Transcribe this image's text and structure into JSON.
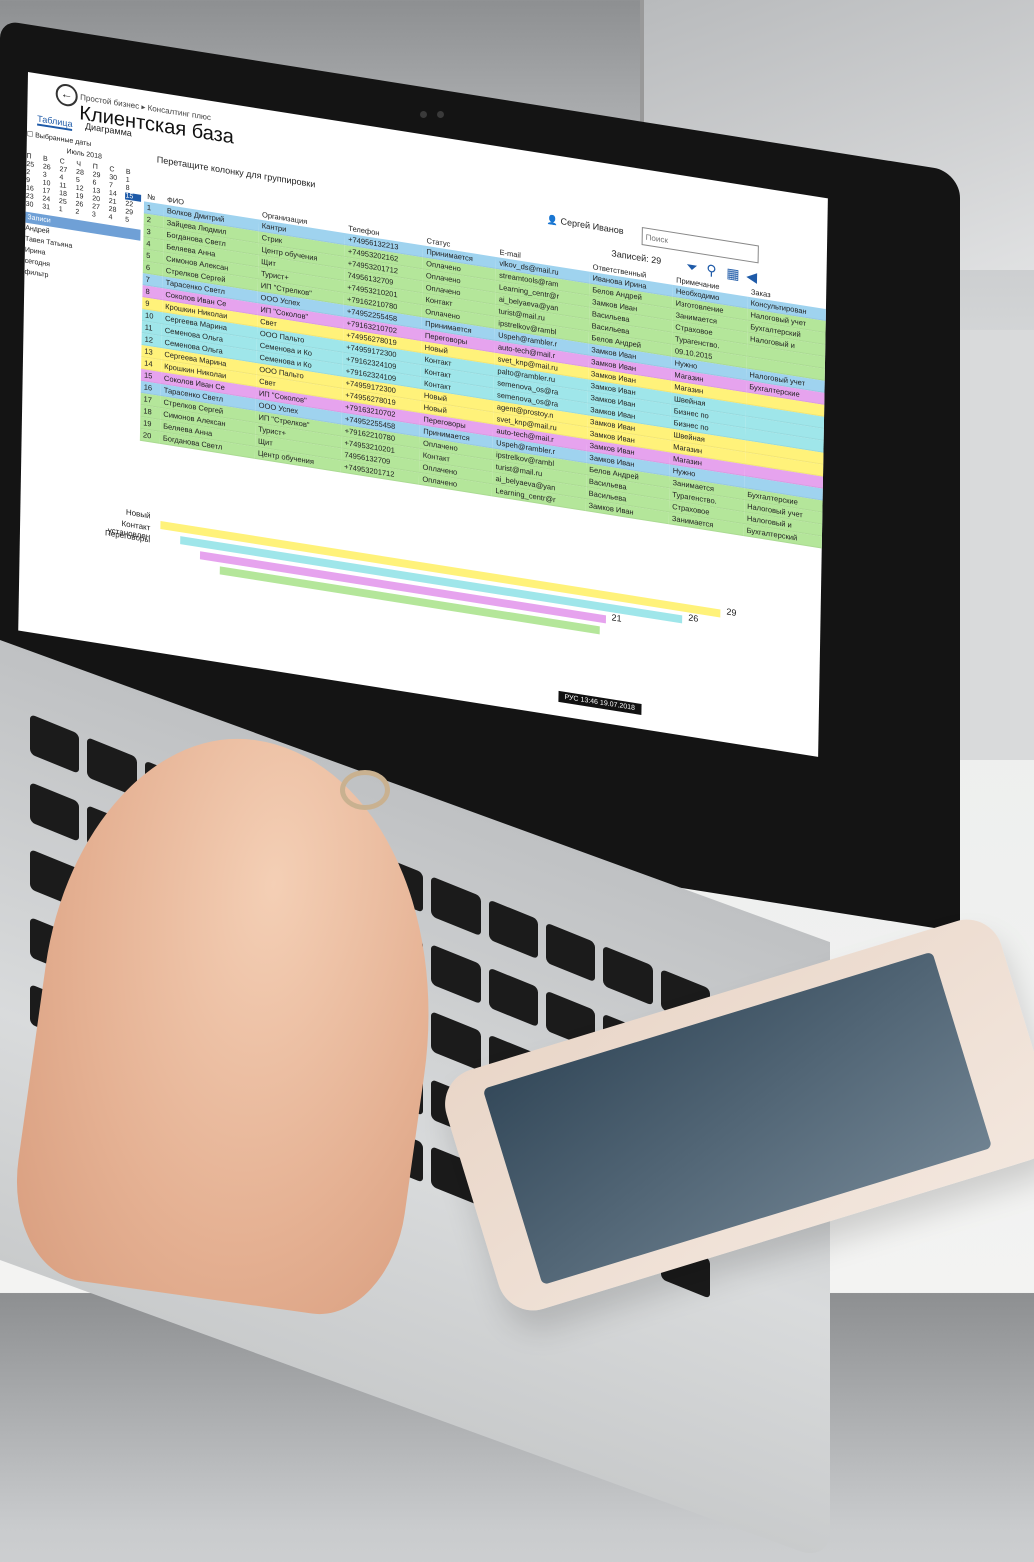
{
  "app": {
    "breadcrumb": "Простой бизнес ▸ Консалтинг плюс",
    "title": "Клиентская база",
    "back_icon": "back-arrow-icon",
    "tabs": [
      {
        "label": "Таблица",
        "active": true
      },
      {
        "label": "Диаграмма",
        "active": false
      }
    ],
    "group_hint": "Перетащите колонку для группировки",
    "user_name": "Сергей Иванов",
    "search_placeholder": "Поиск",
    "records_label": "Записей: 29",
    "accent_color": "#1e5aa8"
  },
  "sidebar": {
    "checkbox_label": "Выбранные даты",
    "month": "Июль 2018",
    "weekdays": [
      "П",
      "В",
      "С",
      "Ч",
      "П",
      "С",
      "В"
    ],
    "days": [
      "25",
      "26",
      "27",
      "28",
      "29",
      "30",
      "1",
      "2",
      "3",
      "4",
      "5",
      "6",
      "7",
      "8",
      "9",
      "10",
      "11",
      "12",
      "13",
      "14",
      "15",
      "16",
      "17",
      "18",
      "19",
      "20",
      "21",
      "22",
      "23",
      "24",
      "25",
      "26",
      "27",
      "28",
      "29",
      "30",
      "31",
      "1",
      "2",
      "3",
      "4",
      "5"
    ],
    "highlight": "Записи",
    "items": [
      "Андрей",
      "Тавея Татьяна",
      "Ирина",
      "сегодня",
      "фильтр"
    ]
  },
  "table": {
    "columns": [
      "№",
      "ФИО",
      "Организация",
      "Телефон",
      "Статус",
      "E-mail",
      "Ответственный",
      "Примечание",
      "Заказ"
    ],
    "rows": [
      {
        "n": "1",
        "name": "Волков Дмитрий",
        "org": "Кантри",
        "phone": "+74956132213",
        "status": "Принимается",
        "email": "vlkov_ds@mail.ru",
        "resp": "Иванова Ирина",
        "note": "Необходимо",
        "order": "Консультирован",
        "color": "#9fd3ef"
      },
      {
        "n": "2",
        "name": "Зайцева Людмил",
        "org": "Стрик",
        "phone": "+74953202162",
        "status": "Оплачено",
        "email": "streamtools@ram",
        "resp": "Белов Андрей",
        "note": "Изготовление",
        "order": "Налоговый учет",
        "color": "#b4e69a"
      },
      {
        "n": "3",
        "name": "Богданова Светл",
        "org": "Центр обучения",
        "phone": "+74953201712",
        "status": "Оплачено",
        "email": "Learning_centr@r",
        "resp": "Замков Иван",
        "note": "Занимается",
        "order": "Бухгалтерский",
        "color": "#b4e69a"
      },
      {
        "n": "4",
        "name": "Беляева Анна",
        "org": "Щит",
        "phone": "74956132709",
        "status": "Оплачено",
        "email": "ai_belyaeva@yan",
        "resp": "Васильева",
        "note": "Страховое",
        "order": "Налоговый и",
        "color": "#b4e69a"
      },
      {
        "n": "5",
        "name": "Симонов Алексан",
        "org": "Турист+",
        "phone": "+74953210201",
        "status": "Контакт",
        "email": "turist@mail.ru",
        "resp": "Васильева",
        "note": "Турагенство.",
        "order": "",
        "color": "#b4e69a"
      },
      {
        "n": "6",
        "name": "Стрелков Сергей",
        "org": "ИП \"Стрелков\"",
        "phone": "+79162210780",
        "status": "Оплачено",
        "email": "ipstrelkov@rambl",
        "resp": "Белов Андрей",
        "note": "09.10.2015",
        "order": "",
        "color": "#b4e69a"
      },
      {
        "n": "7",
        "name": "Тарасенко Светл",
        "org": "ООО Успех",
        "phone": "+74952255458",
        "status": "Принимается",
        "email": "Uspeh@rambler.r",
        "resp": "Замков Иван",
        "note": "Нужно",
        "order": "Налоговый учет",
        "color": "#9fd3ef"
      },
      {
        "n": "8",
        "name": "Соколов Иван Се",
        "org": "ИП \"Соколов\"",
        "phone": "+79163210702",
        "status": "Переговоры",
        "email": "auto-tech@mail.r",
        "resp": "Замков Иван",
        "note": "Магазин",
        "order": "Бухгалтерские",
        "color": "#e6a3ee"
      },
      {
        "n": "9",
        "name": "Крошкин Николаи",
        "org": "Свет",
        "phone": "+74956278019",
        "status": "Новый",
        "email": "svet_knp@mail.ru",
        "resp": "Замков Иван",
        "note": "Магазин",
        "order": "",
        "color": "#fff27a"
      },
      {
        "n": "10",
        "name": "Сергеева Марина",
        "org": "ООО Пальто",
        "phone": "+74959172300",
        "status": "Контакт",
        "email": "palto@rambler.ru",
        "resp": "Замков Иван",
        "note": "Швейная",
        "order": "",
        "color": "#9fe6ea"
      },
      {
        "n": "11",
        "name": "Семенова Ольга",
        "org": "Семенова и Ко",
        "phone": "+79162324109",
        "status": "Контакт",
        "email": "semenova_os@ra",
        "resp": "Замков Иван",
        "note": "Бизнес по",
        "order": "",
        "color": "#9fe6ea"
      },
      {
        "n": "12",
        "name": "Семенова Ольга",
        "org": "Семенова и Ко",
        "phone": "+79162324109",
        "status": "Контакт",
        "email": "semenova_os@ra",
        "resp": "Замков Иван",
        "note": "Бизнес по",
        "order": "",
        "color": "#9fe6ea"
      },
      {
        "n": "13",
        "name": "Сергеева Марина",
        "org": "ООО Пальто",
        "phone": "+74959172300",
        "status": "Новый",
        "email": "agent@prostoy.n",
        "resp": "Замков Иван",
        "note": "Швейная",
        "order": "",
        "color": "#fff27a"
      },
      {
        "n": "14",
        "name": "Крошкин Николаи",
        "org": "Свет",
        "phone": "+74956278019",
        "status": "Новый",
        "email": "svet_knp@mail.ru",
        "resp": "Замков Иван",
        "note": "Магазин",
        "order": "",
        "color": "#fff27a"
      },
      {
        "n": "15",
        "name": "Соколов Иван Се",
        "org": "ИП \"Соколов\"",
        "phone": "+79163210702",
        "status": "Переговоры",
        "email": "auto-tech@mail.r",
        "resp": "Замков Иван",
        "note": "Магазин",
        "order": "",
        "color": "#e6a3ee"
      },
      {
        "n": "16",
        "name": "Тарасенко Светл",
        "org": "ООО Успех",
        "phone": "+74952255458",
        "status": "Принимается",
        "email": "Uspeh@rambler.r",
        "resp": "Замков Иван",
        "note": "Нужно",
        "order": "",
        "color": "#9fd3ef"
      },
      {
        "n": "17",
        "name": "Стрелков Сергей",
        "org": "ИП \"Стрелков\"",
        "phone": "+79162210780",
        "status": "Оплачено",
        "email": "ipstrelkov@rambl",
        "resp": "Белов Андрей",
        "note": "Занимается",
        "order": "Бухгалтерские",
        "color": "#b4e69a"
      },
      {
        "n": "18",
        "name": "Симонов Алексан",
        "org": "Турист+",
        "phone": "+74953210201",
        "status": "Контакт",
        "email": "turist@mail.ru",
        "resp": "Васильева",
        "note": "Турагенство.",
        "order": "Налоговый учет",
        "color": "#b4e69a"
      },
      {
        "n": "19",
        "name": "Беляева Анна",
        "org": "Щит",
        "phone": "74956132709",
        "status": "Оплачено",
        "email": "ai_belyaeva@yan",
        "resp": "Васильева",
        "note": "Страховое",
        "order": "Налоговый и",
        "color": "#b4e69a"
      },
      {
        "n": "20",
        "name": "Богданова Светл",
        "org": "Центр обучения",
        "phone": "+74953201712",
        "status": "Оплачено",
        "email": "Learning_centr@r",
        "resp": "Замков Иван",
        "note": "Занимается",
        "order": "Бухгалтерский",
        "color": "#b4e69a"
      }
    ]
  },
  "chart_data": {
    "type": "bar",
    "categories": [
      "Новый",
      "Контакт установлен",
      "Переговоры",
      ""
    ],
    "values": [
      29,
      26,
      21,
      null
    ],
    "colors": [
      "#fff27a",
      "#9fe6ea",
      "#e6a3ee",
      "#b4e69a"
    ]
  },
  "taskbar": {
    "lang": "РУС",
    "time": "13:46",
    "date": "19.07.2018"
  }
}
